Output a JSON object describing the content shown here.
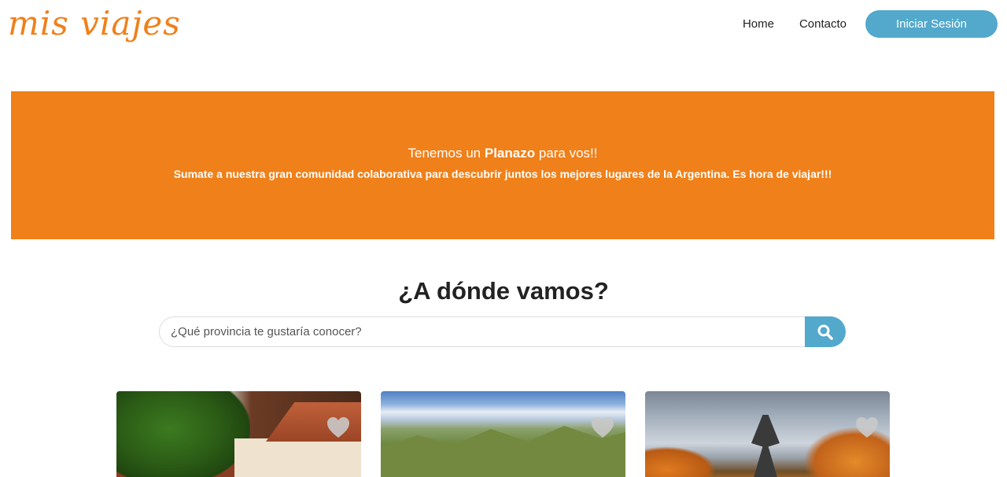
{
  "header": {
    "logo": "mis viajes",
    "nav": {
      "home": "Home",
      "contact": "Contacto",
      "login": "Iniciar Sesión"
    }
  },
  "banner": {
    "headline_pre": "Tenemos un ",
    "headline_bold": "Planazo",
    "headline_post": " para vos!!",
    "subtitle": "Sumate a nuestra gran comunidad colaborativa para descubrir juntos los mejores lugares de la Argentina. Es hora de viajar!!!"
  },
  "search": {
    "title": "¿A dónde vamos?",
    "placeholder": "¿Qué provincia te gustaría conocer?",
    "button_icon": "search-icon"
  },
  "cards": [
    {
      "image": "alpine-village-photo",
      "icon": "heart-icon"
    },
    {
      "image": "mountain-valley-photo",
      "icon": "heart-icon"
    },
    {
      "image": "park-fountain-photo",
      "icon": "heart-icon"
    }
  ],
  "colors": {
    "brand_orange": "#f08019",
    "accent_blue": "#52a9cc"
  }
}
